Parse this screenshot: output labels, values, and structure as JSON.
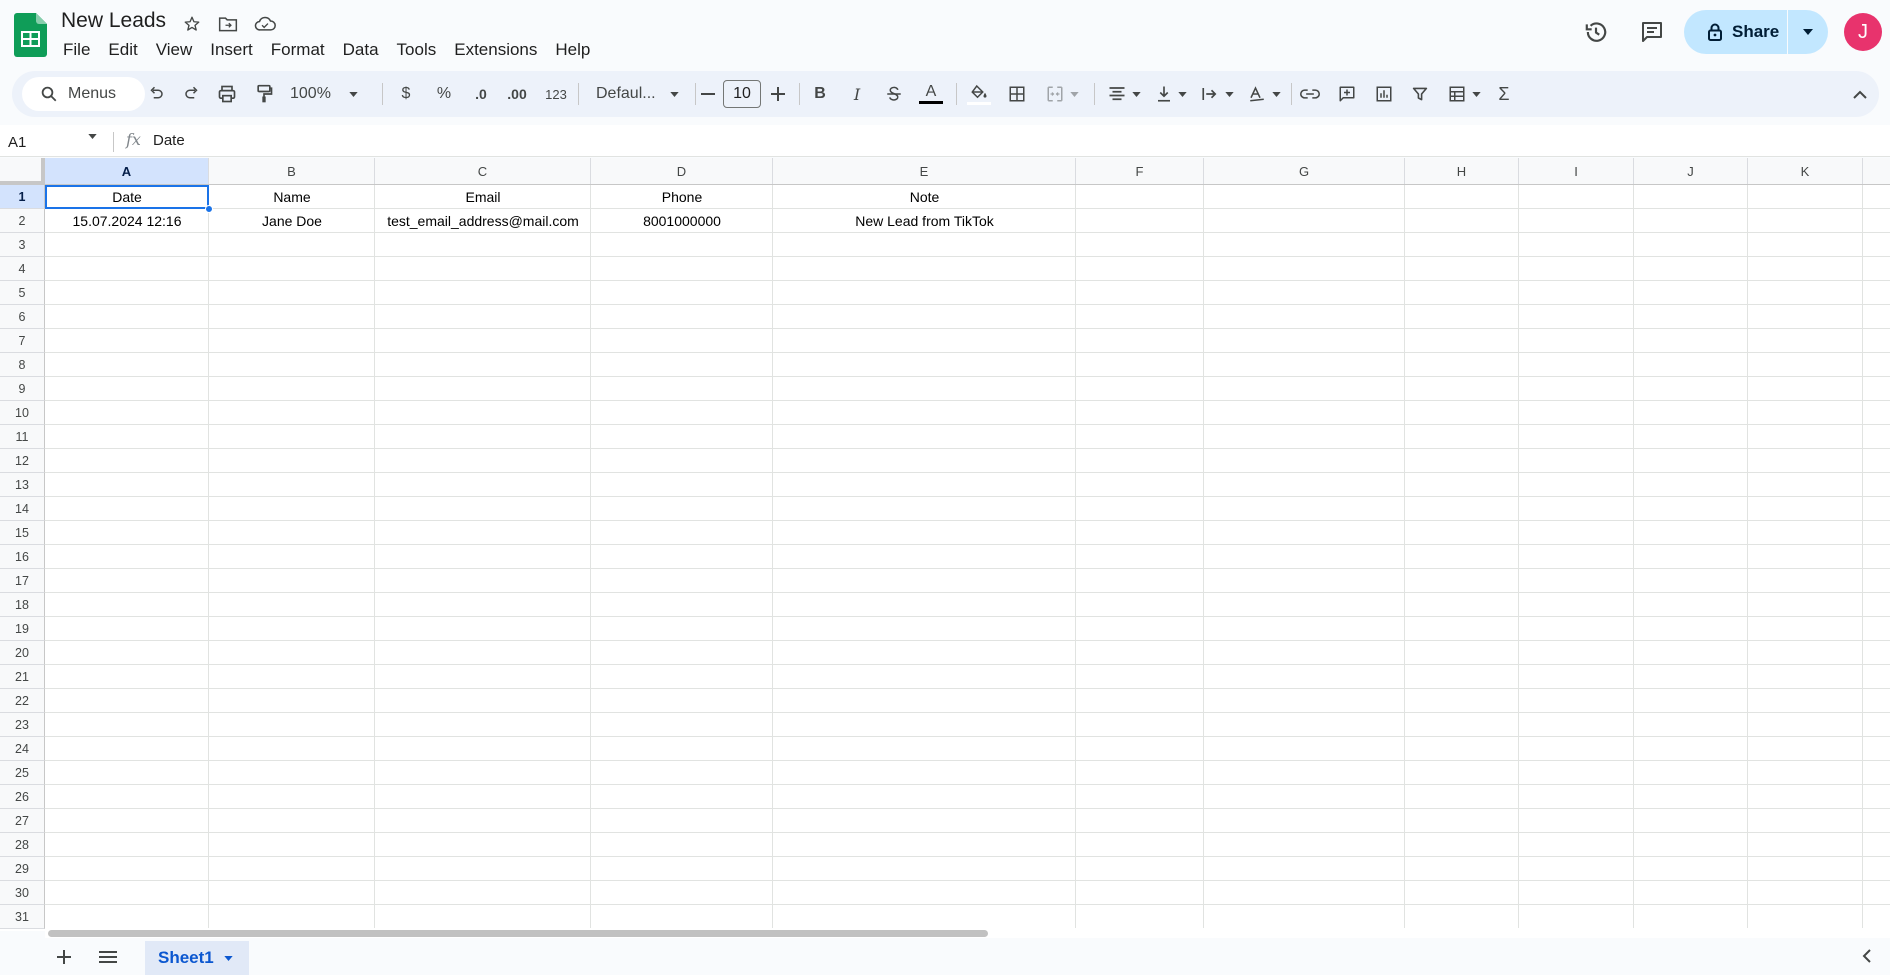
{
  "document": {
    "title": "New Leads"
  },
  "menu": [
    "File",
    "Edit",
    "View",
    "Insert",
    "Format",
    "Data",
    "Tools",
    "Extensions",
    "Help"
  ],
  "topbar": {
    "share_label": "Share",
    "avatar_initial": "J"
  },
  "toolbar": {
    "menus_label": "Menus",
    "zoom": "100%",
    "currency": "$",
    "percent": "%",
    "decrease_decimal": ".0",
    "increase_decimal": ".00",
    "number_format": "123",
    "font": "Defaul...",
    "font_size": "10",
    "bold": "B",
    "italic": "I",
    "text_color_letter": "A",
    "sum": "Σ"
  },
  "formula_bar": {
    "name_box": "A1",
    "fx": "fx",
    "content": "Date"
  },
  "grid": {
    "columns": [
      "A",
      "B",
      "C",
      "D",
      "E",
      "F",
      "G",
      "H",
      "I",
      "J",
      "K"
    ],
    "row_count": 31,
    "selected_cell": "A1",
    "rows": [
      [
        "Date",
        "Name",
        "Email",
        "Phone",
        "Note"
      ],
      [
        "15.07.2024 12:16",
        "Jane Doe",
        "test_email_address@mail.com",
        "8001000000",
        "New Lead from TikTok"
      ]
    ]
  },
  "sheets": {
    "active": "Sheet1"
  },
  "colors": {
    "accent": "#1a73e8",
    "share_bg": "#c2e7ff",
    "avatar_bg": "#e8336d",
    "sheets_green": "#0f9d58"
  }
}
